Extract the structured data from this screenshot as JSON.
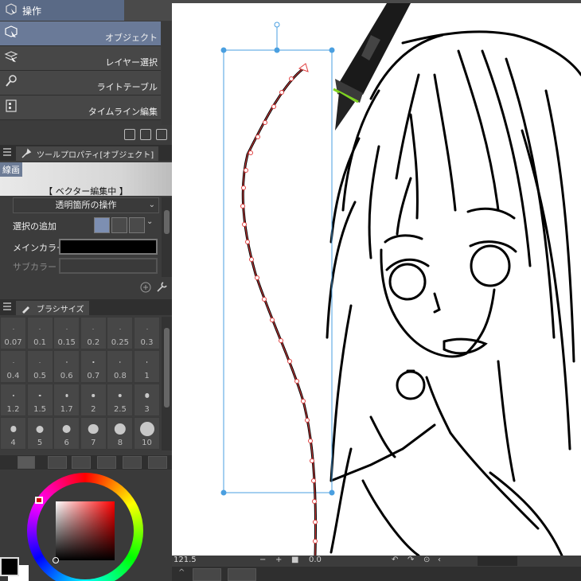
{
  "tool_panel": {
    "active_tab": "操作",
    "subtools": [
      {
        "label": "オブジェクト",
        "selected": true,
        "icon": "object-select-icon"
      },
      {
        "label": "レイヤー選択",
        "selected": false,
        "icon": "layer-select-icon"
      },
      {
        "label": "ライトテーブル",
        "selected": false,
        "icon": "light-table-icon"
      },
      {
        "label": "タイムライン編集",
        "selected": false,
        "icon": "timeline-edit-icon"
      }
    ]
  },
  "tool_property": {
    "tab_label": "ツールプロパティ[オブジェクト]",
    "preview_badge": "線画",
    "preview_mode": "【 ベクター編集中 】",
    "dropdown_value": "透明箇所の操作",
    "add_selection_label": "選択の追加",
    "main_color_label": "メインカラー",
    "sub_color_label": "サブカラー",
    "main_color": "#000000"
  },
  "brush_size": {
    "tab_label": "ブラシサイズ",
    "sizes": [
      "0.07",
      "0.1",
      "0.15",
      "0.2",
      "0.25",
      "0.3",
      "0.4",
      "0.5",
      "0.6",
      "0.7",
      "0.8",
      "1",
      "1.2",
      "1.5",
      "1.7",
      "2",
      "2.5",
      "3",
      "4",
      "5",
      "6",
      "7",
      "8",
      "10"
    ]
  },
  "color": {
    "main": "#000000",
    "sub": "#ffffff",
    "hue": "#ff0000"
  },
  "status_bar": {
    "zoom": "121.5",
    "angle": "0.0"
  }
}
